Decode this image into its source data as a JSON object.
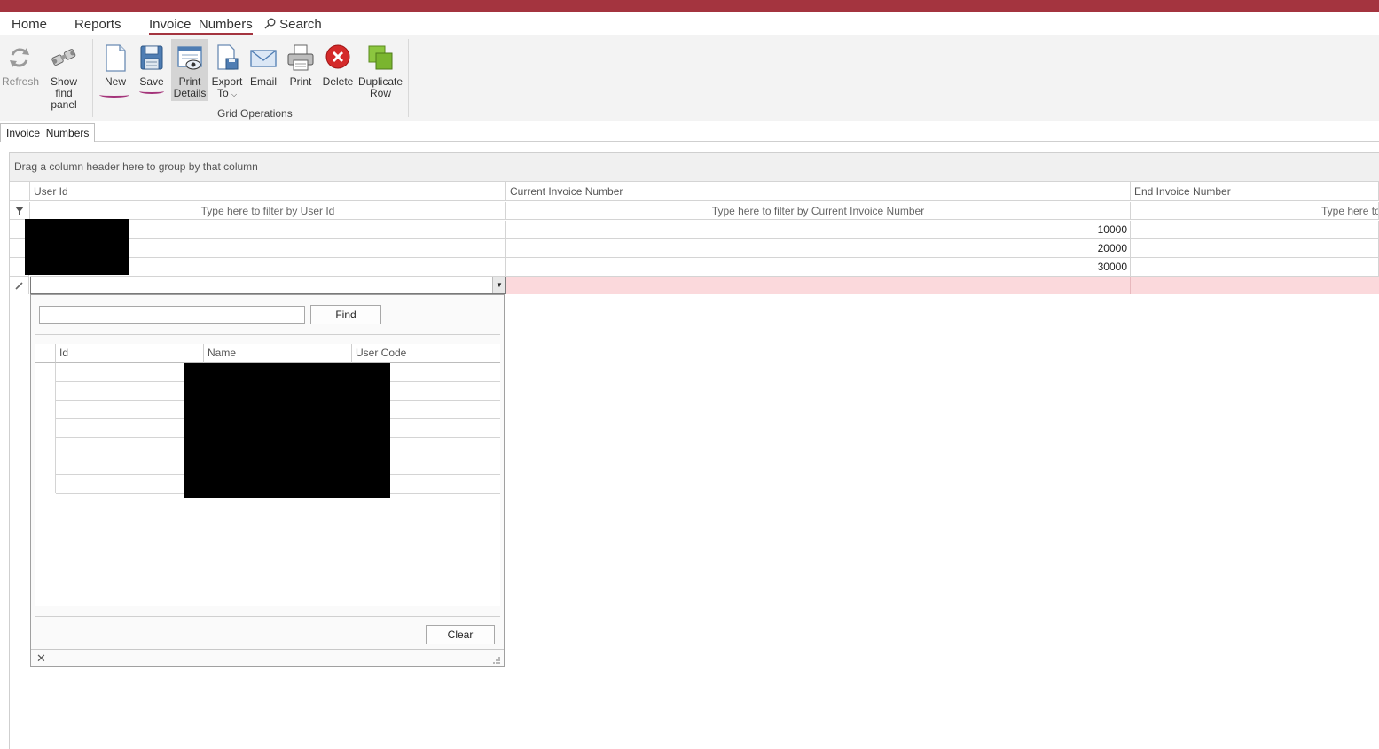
{
  "menu": {
    "home": "Home",
    "reports": "Reports",
    "invoice_numbers": "Invoice  Numbers",
    "search": "Search"
  },
  "toolbar": {
    "refresh": "Refresh",
    "show_find_panel_l1": "Show find",
    "show_find_panel_l2": "panel",
    "new": "New",
    "save": "Save",
    "print_details_l1": "Print",
    "print_details_l2": "Details",
    "export_to_l1": "Export",
    "export_to_l2": "To",
    "email": "Email",
    "print": "Print",
    "delete": "Delete",
    "duplicate_row_l1": "Duplicate",
    "duplicate_row_l2": "Row",
    "group_label": "Grid Operations"
  },
  "doc_tab": "Invoice  Numbers",
  "grid": {
    "group_panel_text": "Drag a column header here to group by that column",
    "columns": [
      "User Id",
      "Current Invoice Number",
      "End Invoice Number"
    ],
    "filters": [
      "Type here to filter by User Id",
      "Type here to filter by Current Invoice Number",
      "Type here to f"
    ],
    "rows": [
      {
        "current_invoice_number": "10000"
      },
      {
        "current_invoice_number": "20000"
      },
      {
        "current_invoice_number": "30000"
      }
    ]
  },
  "lookup_popup": {
    "search_value": "",
    "find_label": "Find",
    "columns": [
      "Id",
      "Name",
      "User Code"
    ],
    "clear_label": "Clear"
  },
  "colors": {
    "title_bar": "#a4343f",
    "new_row": "#fbd9dc",
    "annotation": "#a4347a"
  }
}
